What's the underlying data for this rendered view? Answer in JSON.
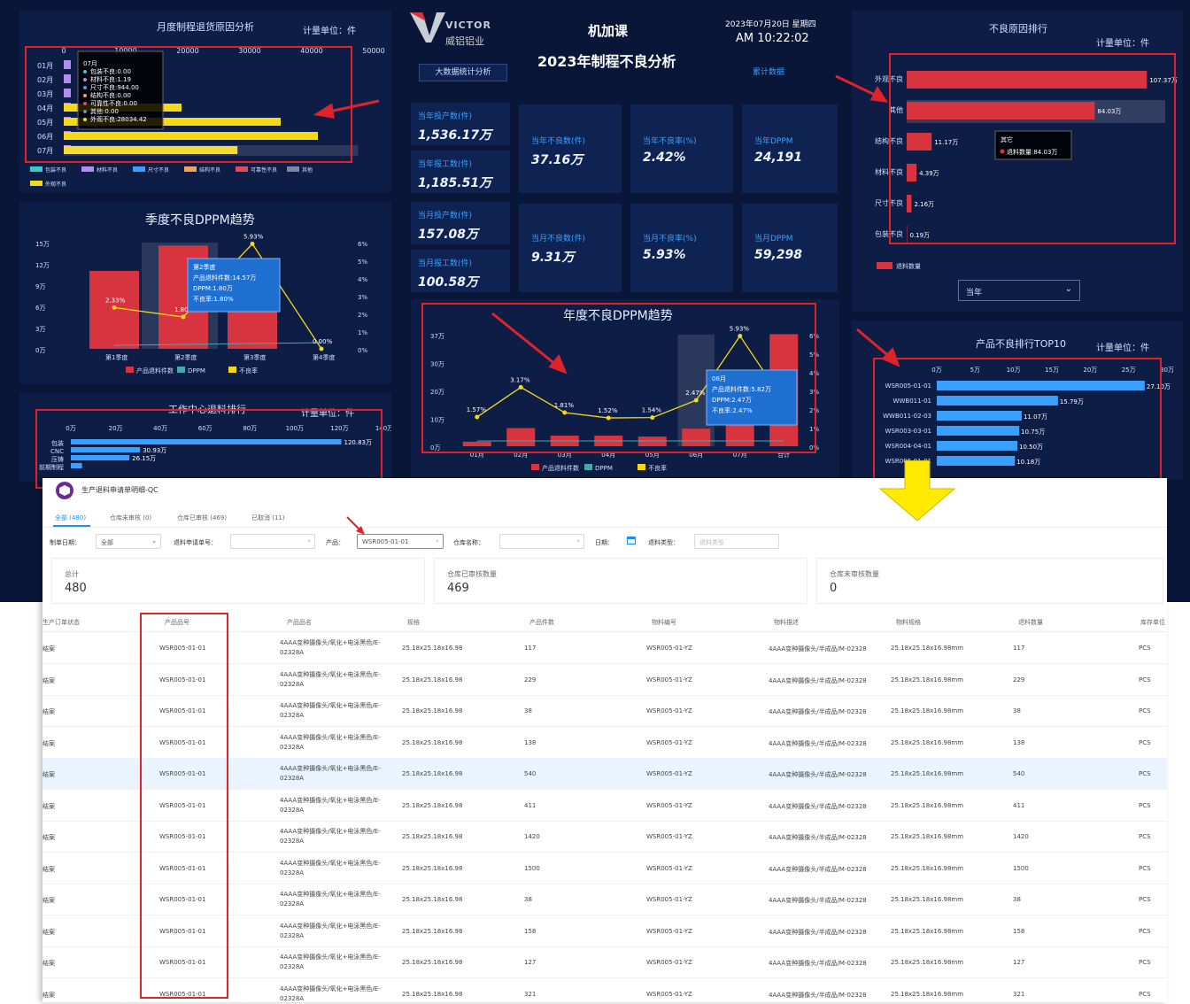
{
  "header": {
    "logo_text": "VICTOR",
    "logo_sub": "威铝铝业",
    "company": "机加课",
    "title": "2023年制程不良分析",
    "date": "2023年07月20日 星期四",
    "time": "AM 10:22:02",
    "btn_big": "大数据统计分析",
    "btn_total": "累计数据"
  },
  "colors": {
    "bg": "#0a1638",
    "panel": "#0d1d45",
    "red": "#d8343f",
    "yellow": "#f5d816",
    "blue": "#3aa0ff",
    "cyan": "#3cc",
    "hl": "#e0232b",
    "arrow": "#ffea00"
  },
  "kpis": [
    {
      "label": "当年投产数(件)",
      "value": "1,536.17万"
    },
    {
      "label": "当年报工数(件)",
      "value": "1,185.51万"
    },
    {
      "label": "当年不良数(件)",
      "value": "37.16万"
    },
    {
      "label": "当年不良率(%)",
      "value": "2.42%"
    },
    {
      "label": "当年DPPM",
      "value": "24,191"
    },
    {
      "label": "当月投产数(件)",
      "value": "157.08万"
    },
    {
      "label": "当月报工数(件)",
      "value": "100.58万"
    },
    {
      "label": "当月不良数(件)",
      "value": "9.31万"
    },
    {
      "label": "当月不良率(%)",
      "value": "5.93%"
    },
    {
      "label": "当月DPPM",
      "value": "59,298"
    }
  ],
  "monthly_panel": {
    "title": "月度制程退货原因分析",
    "unit": "计量单位：件",
    "x_ticks": [
      "0",
      "10000",
      "20000",
      "30000",
      "40000",
      "50000"
    ],
    "months": [
      "01月",
      "02月",
      "03月",
      "04月",
      "05月",
      "06月",
      "07月"
    ],
    "legend": [
      "包装不良",
      "材料不良",
      "尺寸不良",
      "结构不良",
      "可靠性不良",
      "其他",
      "外观不良"
    ],
    "tooltip": [
      "07月",
      "包装不良:0.00",
      "材料不良:1.19",
      "尺寸不良:944.00",
      "结构不良:0.00",
      "可靠性不良:0.00",
      "其他:0.00",
      "外观不良:28034.42"
    ]
  },
  "quarter_panel": {
    "title": "季度不良DPPM趋势",
    "y_left": [
      "15万",
      "12万",
      "9万",
      "6万",
      "3万",
      "0万"
    ],
    "y_right": [
      "6%",
      "5%",
      "4%",
      "3%",
      "2%",
      "1%",
      "0%"
    ],
    "labels": [
      "2.33%",
      "1.80%",
      "5.93%",
      "0.00%"
    ],
    "tooltip": [
      "第2季度",
      "产品退料件数:14.57万",
      "DPPM:1.80万",
      "不良率:1.80%"
    ],
    "legend": [
      "产品退料件数",
      "DPPM",
      "不良率"
    ]
  },
  "work_panel": {
    "title": "工作中心退料排行",
    "unit": "计量单位：件",
    "ticks": [
      "0万",
      "20万",
      "40万",
      "60万",
      "80万",
      "100万",
      "120万",
      "140万"
    ],
    "cats": [
      "包装",
      "CNC",
      "压铸",
      "前期制程"
    ],
    "vals": [
      "120.83万",
      "30.93万",
      "26.15万"
    ]
  },
  "reason_panel": {
    "title": "不良原因排行",
    "unit": "计量单位：件",
    "cats": [
      "外观不良",
      "其他",
      "结构不良",
      "材料不良",
      "尺寸不良",
      "包装不良"
    ],
    "vals": [
      "107.37万",
      "84.03万",
      "11.17万",
      "4.39万",
      "2.16万",
      "0.19万"
    ],
    "tooltip": [
      "其它",
      "退料数量:84.03万"
    ],
    "legend": "退料数量",
    "select": "当年"
  },
  "year_panel": {
    "title": "年度不良DPPM趋势",
    "y_left": [
      "37万",
      "30万",
      "20万",
      "10万",
      "0万"
    ],
    "y_right": [
      "6%",
      "5%",
      "4%",
      "3%",
      "2%",
      "1%",
      "0%"
    ],
    "months": [
      "01月",
      "02月",
      "03月",
      "04月",
      "05月",
      "06月",
      "07月",
      "合计"
    ],
    "labels": [
      "1.57%",
      "3.17%",
      "1.81%",
      "1.52%",
      "1.54%",
      "2.47%",
      "5.93%"
    ],
    "tooltip": [
      "06月",
      "产品退料件数:5.82万",
      "DPPM:2.47万",
      "不良率:2.47%"
    ],
    "legend": [
      "产品退料件数",
      "DPPM",
      "不良率"
    ]
  },
  "top10_panel": {
    "title": "产品不良排行TOP10",
    "unit": "计量单位：件",
    "ticks": [
      "0万",
      "5万",
      "10万",
      "15万",
      "20万",
      "25万",
      "30万"
    ],
    "cats": [
      "WSR005-01-01",
      "WWB011-01",
      "WWB011-02-03",
      "WSR003-03-01",
      "WSR004-04-01",
      "WSR006-01-01"
    ],
    "vals": [
      "27.10万",
      "15.79万",
      "11.07万",
      "10.75万",
      "10.50万",
      "10.18万"
    ]
  },
  "sheet": {
    "app_title": "生产退料申请单明细-QC",
    "tabs": [
      "全部 (480)",
      "仓库未审核 (0)",
      "仓库已审核 (469)",
      "已取消 (11)"
    ],
    "filters": {
      "lbl_date": "制单日期：",
      "sel_date": "全部",
      "lbl_no": "退料申请单号：",
      "lbl_prod": "产品：",
      "val_prod": "WSR005-01-01",
      "lbl_wh": "仓库名称：",
      "lbl_day": "日期：",
      "lbl_type": "退料类型：",
      "ph_type": "退料类型"
    },
    "stats": [
      {
        "label": "总计",
        "value": "480"
      },
      {
        "label": "仓库已审核数量",
        "value": "469"
      },
      {
        "label": "仓库未审核数量",
        "value": "0"
      }
    ],
    "headers": [
      "生产订单状态",
      "产品品号",
      "产品品名",
      "规格",
      "产品件数",
      "物料编号",
      "物料描述",
      "物料规格",
      "退料数量",
      "库存单位"
    ],
    "rows": [
      {
        "status": "结案",
        "code": "WSR005-01-01",
        "name": "4AAA变种摄像头/氧化+电泳黑色/E-02328A",
        "spec": "25.18x25.18x16.98",
        "qty": "117",
        "mat": "WSR005-01-YZ",
        "desc": "4AAA变种摄像头/半成品/M-02328",
        "mspec": "25.18x25.18x16.98mm",
        "ret": "117",
        "unit": "PCS"
      },
      {
        "status": "结案",
        "code": "WSR005-01-01",
        "name": "4AAA变种摄像头/氧化+电泳黑色/E-02328A",
        "spec": "25.18x25.18x16.98",
        "qty": "229",
        "mat": "WSR005-01-YZ",
        "desc": "4AAA变种摄像头/半成品/M-02328",
        "mspec": "25.18x25.18x16.98mm",
        "ret": "229",
        "unit": "PCS"
      },
      {
        "status": "结案",
        "code": "WSR005-01-01",
        "name": "4AAA变种摄像头/氧化+电泳黑色/E-02328A",
        "spec": "25.18x25.18x16.98",
        "qty": "38",
        "mat": "WSR005-01-YZ",
        "desc": "4AAA变种摄像头/半成品/M-02328",
        "mspec": "25.18x25.18x16.98mm",
        "ret": "38",
        "unit": "PCS"
      },
      {
        "status": "结案",
        "code": "WSR005-01-01",
        "name": "4AAA变种摄像头/氧化+电泳黑色/E-02328A",
        "spec": "25.18x25.18x16.98",
        "qty": "138",
        "mat": "WSR005-01-YZ",
        "desc": "4AAA变种摄像头/半成品/M-02328",
        "mspec": "25.18x25.18x16.98mm",
        "ret": "138",
        "unit": "PCS"
      },
      {
        "status": "结案",
        "code": "WSR005-01-01",
        "name": "4AAA变种摄像头/氧化+电泳黑色/E-02328A",
        "spec": "25.18x25.18x16.98",
        "qty": "540",
        "mat": "WSR005-01-YZ",
        "desc": "4AAA变种摄像头/半成品/M-02328",
        "mspec": "25.18x25.18x16.98mm",
        "ret": "540",
        "unit": "PCS"
      },
      {
        "status": "结案",
        "code": "WSR005-01-01",
        "name": "4AAA变种摄像头/氧化+电泳黑色/E-02328A",
        "spec": "25.18x25.18x16.98",
        "qty": "411",
        "mat": "WSR005-01-YZ",
        "desc": "4AAA变种摄像头/半成品/M-02328",
        "mspec": "25.18x25.18x16.98mm",
        "ret": "411",
        "unit": "PCS"
      },
      {
        "status": "结案",
        "code": "WSR005-01-01",
        "name": "4AAA变种摄像头/氧化+电泳黑色/E-02328A",
        "spec": "25.18x25.18x16.98",
        "qty": "1420",
        "mat": "WSR005-01-YZ",
        "desc": "4AAA变种摄像头/半成品/M-02328",
        "mspec": "25.18x25.18x16.98mm",
        "ret": "1420",
        "unit": "PCS"
      },
      {
        "status": "结案",
        "code": "WSR005-01-01",
        "name": "4AAA变种摄像头/氧化+电泳黑色/E-02328A",
        "spec": "25.18x25.18x16.98",
        "qty": "1500",
        "mat": "WSR005-01-YZ",
        "desc": "4AAA变种摄像头/半成品/M-02328",
        "mspec": "25.18x25.18x16.98mm",
        "ret": "1500",
        "unit": "PCS"
      },
      {
        "status": "结案",
        "code": "WSR005-01-01",
        "name": "4AAA变种摄像头/氧化+电泳黑色/E-02328A",
        "spec": "25.18x25.18x16.98",
        "qty": "38",
        "mat": "WSR005-01-YZ",
        "desc": "4AAA变种摄像头/半成品/M-02328",
        "mspec": "25.18x25.18x16.98mm",
        "ret": "38",
        "unit": "PCS"
      },
      {
        "status": "结案",
        "code": "WSR005-01-01",
        "name": "4AAA变种摄像头/氧化+电泳黑色/E-02328A",
        "spec": "25.18x25.18x16.98",
        "qty": "158",
        "mat": "WSR005-01-YZ",
        "desc": "4AAA变种摄像头/半成品/M-02328",
        "mspec": "25.18x25.18x16.98mm",
        "ret": "158",
        "unit": "PCS"
      },
      {
        "status": "结案",
        "code": "WSR005-01-01",
        "name": "4AAA变种摄像头/氧化+电泳黑色/E-02328A",
        "spec": "25.18x25.18x16.98",
        "qty": "127",
        "mat": "WSR005-01-YZ",
        "desc": "4AAA变种摄像头/半成品/M-02328",
        "mspec": "25.18x25.18x16.98mm",
        "ret": "127",
        "unit": "PCS"
      },
      {
        "status": "结案",
        "code": "WSR005-01-01",
        "name": "4AAA变种摄像头/氧化+电泳黑色/E-02328A",
        "spec": "25.18x25.18x16.98",
        "qty": "321",
        "mat": "WSR005-01-YZ",
        "desc": "4AAA变种摄像头/半成品/M-02328",
        "mspec": "25.18x25.18x16.98mm",
        "ret": "321",
        "unit": "PCS"
      }
    ]
  },
  "chart_data": [
    {
      "type": "bar",
      "orientation": "horizontal",
      "title": "月度制程退货原因分析",
      "categories": [
        "01月",
        "02月",
        "03月",
        "04月",
        "05月",
        "06月",
        "07月"
      ],
      "series": [
        {
          "name": "外观不良",
          "values": [
            0,
            0,
            0,
            19000,
            35000,
            41000,
            28034.42
          ]
        },
        {
          "name": "尺寸不良",
          "values": [
            0,
            0,
            0,
            0,
            0,
            0,
            944
          ]
        }
      ],
      "xlim": [
        0,
        50000
      ]
    },
    {
      "type": "bar",
      "title": "季度不良DPPM趋势",
      "categories": [
        "第1季度",
        "第2季度",
        "第3季度",
        "第4季度"
      ],
      "series": [
        {
          "name": "产品退料件数",
          "values": [
            11,
            14.57,
            10.5,
            0
          ]
        },
        {
          "name": "DPPM",
          "values": [
            2.33,
            1.8,
            5.93,
            0
          ]
        },
        {
          "name": "不良率",
          "values": [
            2.33,
            1.8,
            5.93,
            0
          ]
        }
      ],
      "ylim": [
        0,
        15
      ],
      "y2lim": [
        0,
        6
      ]
    },
    {
      "type": "bar",
      "orientation": "horizontal",
      "title": "工作中心退料排行",
      "categories": [
        "包装",
        "CNC",
        "压铸",
        "前期制程"
      ],
      "values": [
        120.83,
        30.93,
        26.15,
        5
      ],
      "xlim": [
        0,
        140
      ]
    },
    {
      "type": "bar",
      "orientation": "horizontal",
      "title": "不良原因排行",
      "categories": [
        "外观不良",
        "其他",
        "结构不良",
        "材料不良",
        "尺寸不良",
        "包装不良"
      ],
      "values": [
        107.37,
        84.03,
        11.17,
        4.39,
        2.16,
        0.19
      ],
      "xlim": [
        0,
        120
      ]
    },
    {
      "type": "bar",
      "title": "年度不良DPPM趋势",
      "categories": [
        "01月",
        "02月",
        "03月",
        "04月",
        "05月",
        "06月",
        "07月",
        "合计"
      ],
      "series": [
        {
          "name": "产品退料件数",
          "values": [
            1.5,
            6,
            3.5,
            3.5,
            3.2,
            5.82,
            9.31,
            37.16
          ]
        },
        {
          "name": "不良率",
          "values": [
            1.57,
            3.17,
            1.81,
            1.52,
            1.54,
            2.47,
            5.93,
            2.42
          ]
        }
      ],
      "ylim": [
        0,
        37
      ],
      "y2lim": [
        0,
        6
      ]
    },
    {
      "type": "bar",
      "orientation": "horizontal",
      "title": "产品不良排行TOP10",
      "categories": [
        "WSR005-01-01",
        "WWB011-01",
        "WWB011-02-03",
        "WSR003-03-01",
        "WSR004-04-01",
        "WSR006-01-01"
      ],
      "values": [
        27.1,
        15.79,
        11.07,
        10.75,
        10.5,
        10.18
      ],
      "xlim": [
        0,
        30
      ]
    }
  ]
}
